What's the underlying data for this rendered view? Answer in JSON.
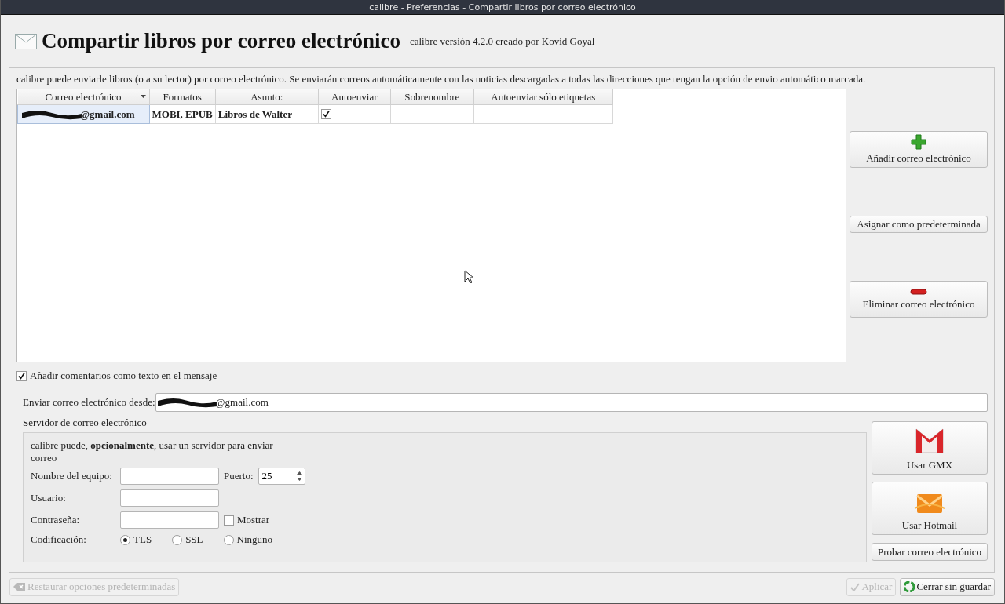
{
  "window": {
    "title": "calibre - Preferencias - Compartir libros por correo electrónico"
  },
  "header": {
    "title": "Compartir libros por correo electrónico",
    "subtitle": "calibre versión 4.2.0 creado por Kovid Goyal"
  },
  "intro": "calibre puede enviarle libros (o a su lector) por correo electrónico. Se enviarán correos automáticamente con las noticias descargadas a todas las direcciones que tengan la opción de envio automático marcada.",
  "table": {
    "columns": [
      {
        "label": "Correo electrónico",
        "sorted": true
      },
      {
        "label": "Formatos",
        "sorted": false
      },
      {
        "label": "Asunto:",
        "sorted": false
      },
      {
        "label": "Autoenviar",
        "sorted": false
      },
      {
        "label": "Sobrenombre",
        "sorted": false
      },
      {
        "label": "Autoenviar sólo etiquetas",
        "sorted": false
      }
    ],
    "rows": [
      {
        "email": "@gmail.com",
        "redacted": true,
        "selected": true,
        "formats": "MOBI, EPUB",
        "subject": "Libros de Walter",
        "auto_send": true
      }
    ]
  },
  "email_buttons": [
    {
      "kind": "add",
      "label": "Añadir correo electrónico"
    },
    {
      "kind": "default",
      "label": "Asignar como predeterminada"
    },
    {
      "kind": "remove",
      "label": "Eliminar correo electrónico"
    }
  ],
  "comments_option": {
    "label": "Añadir comentarios como texto en el mensaje",
    "checked": true
  },
  "send_from": {
    "label": "Enviar correo electrónico desde:",
    "value": "@gmail.com",
    "redacted": true
  },
  "server": {
    "title": "Servidor de correo electrónico",
    "note": "calibre puede, **opcionalmente**, usar un servidor para enviar correo",
    "hostname": {
      "label": "Nombre del equipo:"
    },
    "port": {
      "label": "Puerto:",
      "value": "25"
    },
    "username": {
      "label": "Usuario:"
    },
    "password": {
      "label": "Contraseña:"
    },
    "show_password": {
      "label": "Mostrar",
      "checked": false
    },
    "encryption": {
      "label": "Codificación:",
      "options": [
        {
          "label": "TLS",
          "selected": true
        },
        {
          "label": "SSL",
          "selected": false
        },
        {
          "label": "Ninguno",
          "selected": false
        }
      ]
    }
  },
  "provider_buttons": [
    {
      "kind": "gmx",
      "label": "Usar GMX"
    },
    {
      "kind": "hotmail",
      "label": "Usar Hotmail"
    }
  ],
  "test_button": {
    "label": "Probar correo electrónico"
  },
  "footer": {
    "restore": {
      "label": "Restaurar opciones predeterminadas",
      "disabled": true
    },
    "apply": {
      "label": "Aplicar",
      "disabled": true
    },
    "close": {
      "label": "Cerrar sin guardar",
      "disabled": false
    }
  }
}
